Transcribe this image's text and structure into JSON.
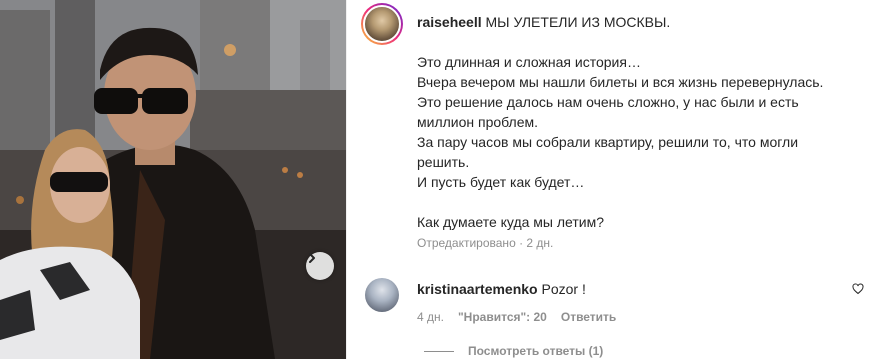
{
  "post": {
    "author": "raiseheell",
    "caption_lines": [
      "МЫ УЛЕТЕЛИ ИЗ МОСКВЫ.",
      "",
      "Это длинная и сложная история…",
      "Вчера вечером мы нашли билеты и вся жизнь перевернулась.",
      "Это решение далось нам очень сложно, у нас были и есть",
      "миллион проблем.",
      "За пару часов мы собрали квартиру, решили то, что могли",
      "решить.",
      "И пусть будет как будет…",
      "",
      "Как думаете куда мы летим?"
    ],
    "edited_label": "Отредактировано",
    "separator": " · ",
    "age": "2 дн."
  },
  "comment": {
    "author": "kristinaartemenko",
    "text": "Pozor !",
    "age": "4 дн.",
    "likes_label": "\"Нравится\": 20",
    "reply_label": "Ответить"
  },
  "replies": {
    "label": "Посмотреть ответы (1)"
  },
  "icons": {
    "next": "chevron-right-icon",
    "like": "heart-icon"
  },
  "colors": {
    "text": "#262626",
    "secondary": "#8e8e8e"
  }
}
